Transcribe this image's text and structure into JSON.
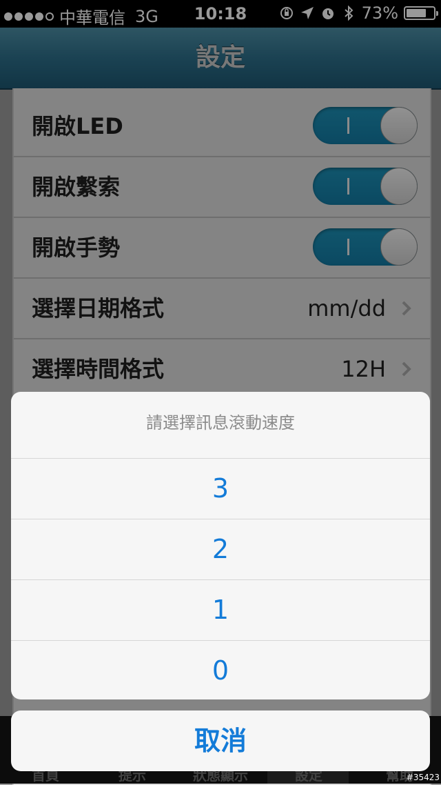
{
  "status_bar": {
    "signal_bars_filled": 4,
    "signal_bars_total": 5,
    "carrier": "中華電信",
    "network": "3G",
    "time": "10:18",
    "icons": [
      "orientation-lock-icon",
      "location-arrow-icon",
      "alarm-icon",
      "bluetooth-icon"
    ],
    "battery_percent": "73%",
    "battery_level": 0.73
  },
  "nav": {
    "title": "設定"
  },
  "settings": {
    "rows": [
      {
        "label": "開啟LED",
        "type": "toggle",
        "on": true
      },
      {
        "label": "開啟繫索",
        "type": "toggle",
        "on": true
      },
      {
        "label": "開啟手勢",
        "type": "toggle",
        "on": true
      },
      {
        "label": "選擇日期格式",
        "type": "disclosure",
        "value": "mm/dd"
      },
      {
        "label": "選擇時間格式",
        "type": "disclosure",
        "value": "12H"
      }
    ]
  },
  "tab_bar": {
    "tabs": [
      "首頁",
      "提示",
      "狀態顯示",
      "設定",
      "幫助"
    ],
    "active": "設定"
  },
  "action_sheet": {
    "title": "請選擇訊息滾動速度",
    "options": [
      "3",
      "2",
      "1",
      "0"
    ],
    "cancel_label": "取消"
  },
  "watermark": "#35423",
  "colors": {
    "nav_bar": "#2d6f8a",
    "toggle_on": "#1a87b0",
    "action_blue": "#137bd8"
  }
}
